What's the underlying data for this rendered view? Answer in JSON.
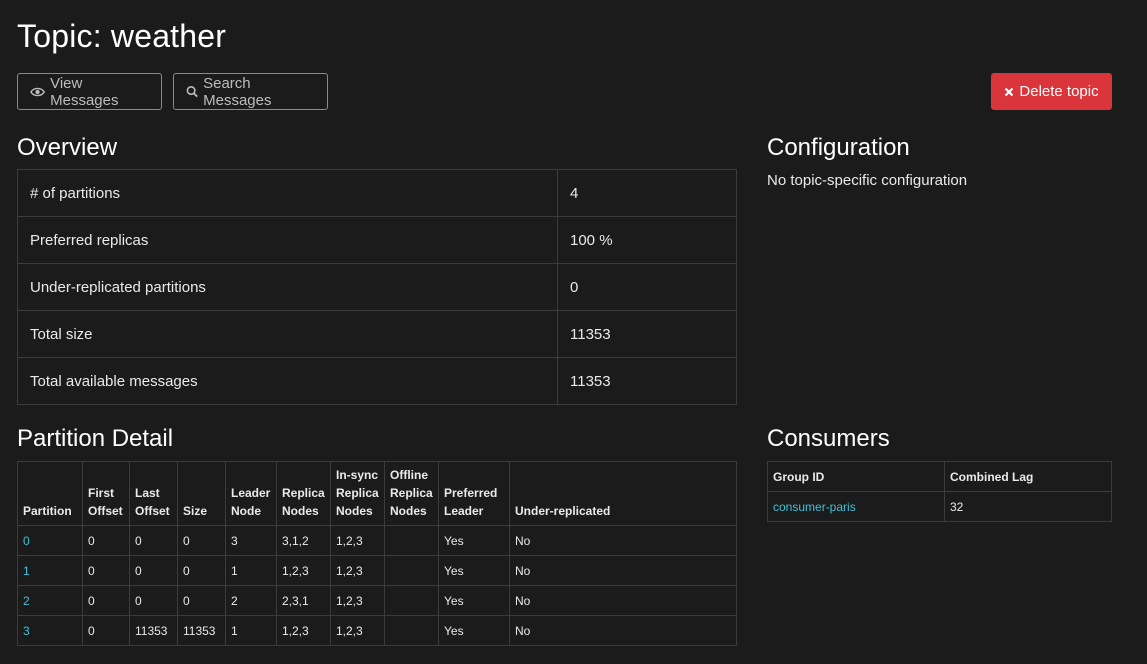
{
  "page": {
    "title": "Topic: weather"
  },
  "toolbar": {
    "view_messages": "View Messages",
    "search_messages": "Search Messages",
    "delete_topic": "Delete topic"
  },
  "overview": {
    "heading": "Overview",
    "rows": [
      {
        "label": "# of partitions",
        "value": "4"
      },
      {
        "label": "Preferred replicas",
        "value": "100 %"
      },
      {
        "label": "Under-replicated partitions",
        "value": "0"
      },
      {
        "label": "Total size",
        "value": "11353"
      },
      {
        "label": "Total available messages",
        "value": "11353"
      }
    ]
  },
  "configuration": {
    "heading": "Configuration",
    "text": "No topic-specific configuration"
  },
  "partition_detail": {
    "heading": "Partition Detail",
    "headers": [
      "Partition",
      "First Offset",
      "Last Offset",
      "Size",
      "Leader Node",
      "Replica Nodes",
      "In-sync Replica Nodes",
      "Offline Replica Nodes",
      "Preferred Leader",
      "Under-replicated"
    ],
    "rows": [
      [
        "0",
        "0",
        "0",
        "0",
        "3",
        "3,1,2",
        "1,2,3",
        "",
        "Yes",
        "No"
      ],
      [
        "1",
        "0",
        "0",
        "0",
        "1",
        "1,2,3",
        "1,2,3",
        "",
        "Yes",
        "No"
      ],
      [
        "2",
        "0",
        "0",
        "0",
        "2",
        "2,3,1",
        "1,2,3",
        "",
        "Yes",
        "No"
      ],
      [
        "3",
        "0",
        "11353",
        "11353",
        "1",
        "1,2,3",
        "1,2,3",
        "",
        "Yes",
        "No"
      ]
    ]
  },
  "consumers": {
    "heading": "Consumers",
    "headers": [
      "Group ID",
      "Combined Lag"
    ],
    "rows": [
      [
        "consumer-paris",
        "32"
      ]
    ]
  },
  "colors": {
    "accent": "#3cc3d9",
    "danger": "#d9353a",
    "background": "#1b1b1b"
  },
  "icons": {
    "view": "eye-icon",
    "search": "search-icon",
    "delete": "close-icon"
  }
}
